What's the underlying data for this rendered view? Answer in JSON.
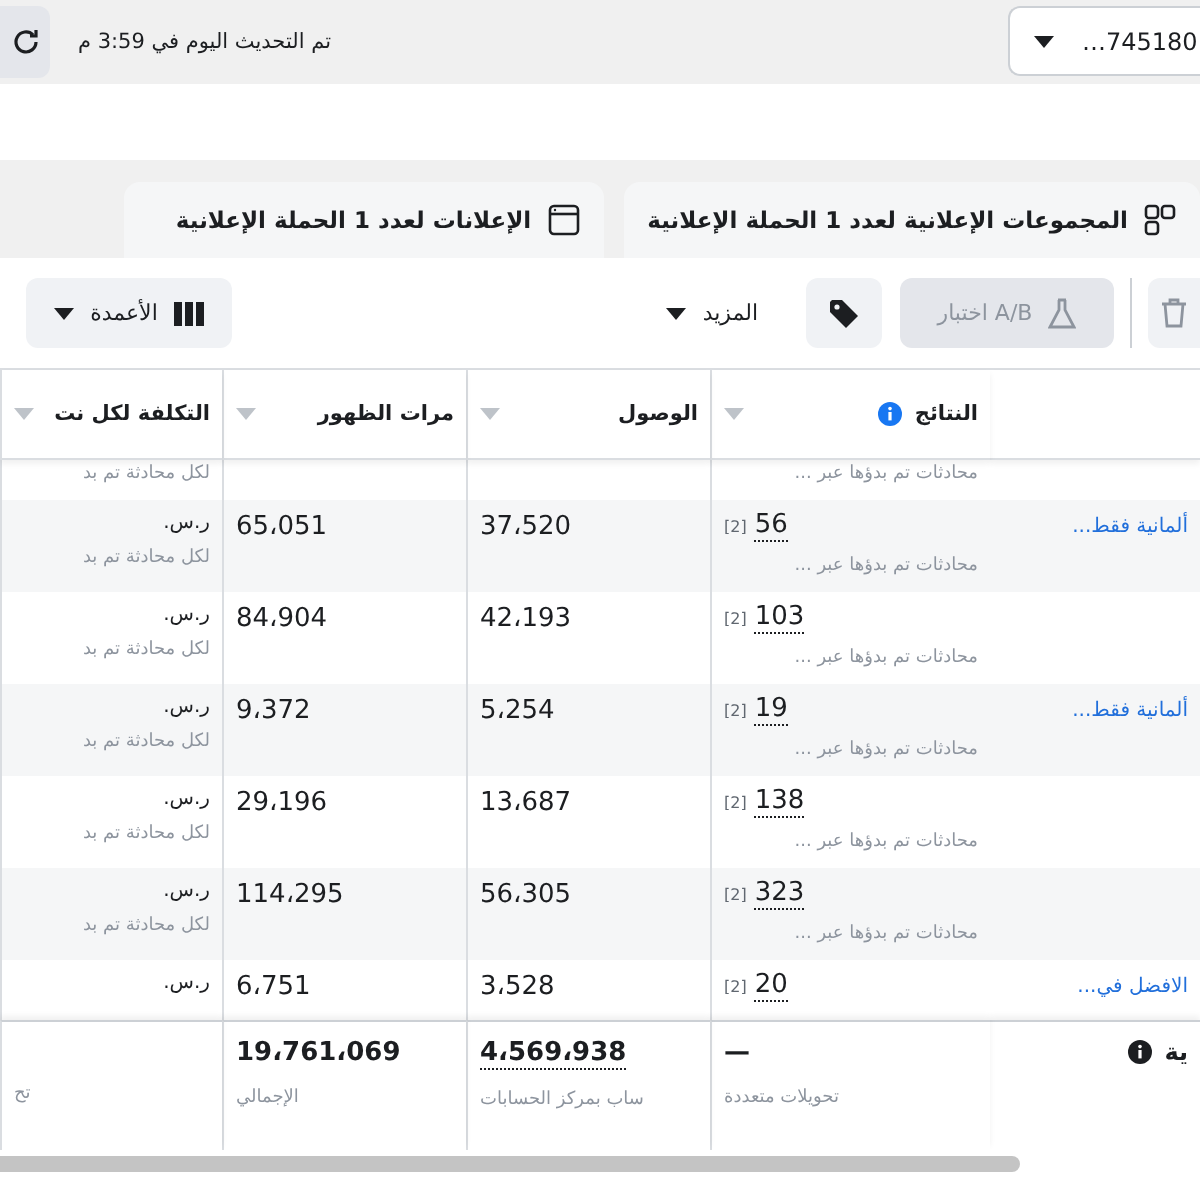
{
  "top_bar": {
    "updated_text": "تم التحديث اليوم في 3:59 م",
    "account_selector": "…745180"
  },
  "tabs": [
    {
      "label": "المجموعات الإعلانية لعدد 1 الحملة الإعلانية"
    },
    {
      "label": "الإعلانات لعدد 1 الحملة الإعلانية"
    }
  ],
  "toolbar": {
    "columns_label": "الأعمدة",
    "more_label": "المزيد",
    "ab_test": {
      "label": "اختبار A/B",
      "disabled": true
    }
  },
  "table": {
    "columns": [
      {
        "label": "النتائج",
        "info": true
      },
      {
        "label": "الوصول",
        "info": false
      },
      {
        "label": "مرات الظهور",
        "info": false
      },
      {
        "label": "التكلفة لكل نت",
        "info": false
      }
    ],
    "rows": [
      {
        "cost_sub": "لكل محادثة تم بد",
        "results_sub": "محادثات تم بدؤها عبر ..."
      },
      {
        "column_5": "ألمانية فقط...",
        "results": "56",
        "note": "[2]",
        "results_sub": "محادثات تم بدؤها عبر ...",
        "reach": "37،520",
        "impressions": "65،051",
        "cost": "ر.س.",
        "cost_sub": "لكل محادثة تم بد"
      },
      {
        "results": "103",
        "note": "[2]",
        "results_sub": "محادثات تم بدؤها عبر ...",
        "reach": "42،193",
        "impressions": "84،904",
        "cost": "ر.س.",
        "cost_sub": "لكل محادثة تم بد"
      },
      {
        "column_5": "ألمانية فقط...",
        "results": "19",
        "note": "[2]",
        "results_sub": "محادثات تم بدؤها عبر ...",
        "reach": "5،254",
        "impressions": "9،372",
        "cost": "ر.س.",
        "cost_sub": "لكل محادثة تم بد"
      },
      {
        "results": "138",
        "note": "[2]",
        "results_sub": "محادثات تم بدؤها عبر ...",
        "reach": "13،687",
        "impressions": "29،196",
        "cost": "ر.س.",
        "cost_sub": "لكل محادثة تم بد"
      },
      {
        "results": "323",
        "note": "[2]",
        "results_sub": "محادثات تم بدؤها عبر ...",
        "reach": "56،305",
        "impressions": "114،295",
        "cost": "ر.س.",
        "cost_sub": "لكل محادثة تم بد"
      },
      {
        "column_5": "الافضل في...",
        "results": "20",
        "note": "[2]",
        "reach": "3،528",
        "impressions": "6،751",
        "cost": "ر.س."
      }
    ],
    "footer": [
      {
        "value": "ية",
        "info": true
      },
      {
        "value": "—",
        "sub": "تحويلات متعددة"
      },
      {
        "value": "4،569،938",
        "sub": "ساب بمركز الحسابات",
        "underline": true
      },
      {
        "value": "19،761،069",
        "sub": "الإجمالي"
      },
      {
        "sub": "تح"
      }
    ]
  }
}
